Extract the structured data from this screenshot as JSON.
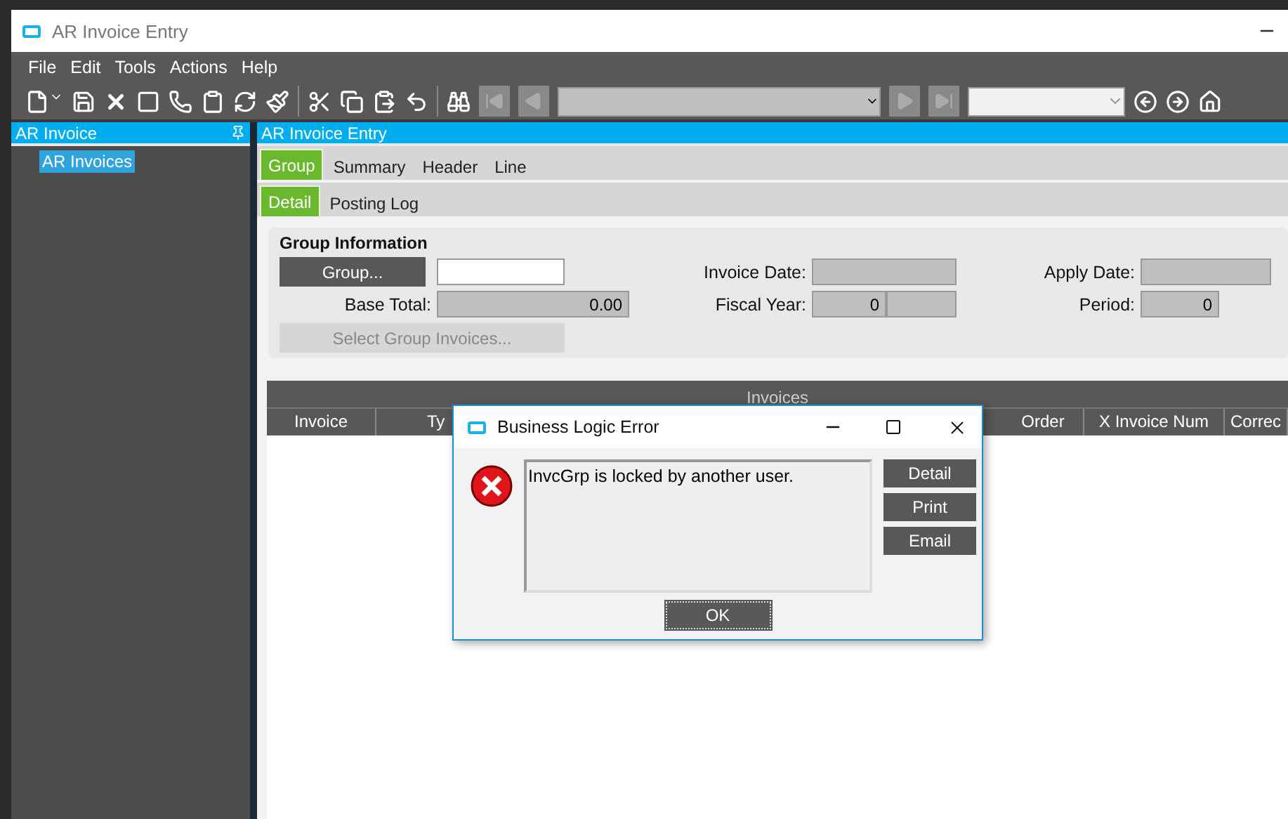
{
  "window": {
    "title": "AR Invoice Entry"
  },
  "menu": [
    "File",
    "Edit",
    "Tools",
    "Actions",
    "Help"
  ],
  "sidebar": {
    "title": "AR Invoice",
    "items": [
      {
        "label": "AR Invoices",
        "selected": true
      }
    ]
  },
  "panel": {
    "title": "AR Invoice Entry"
  },
  "tabs": [
    {
      "label": "Group",
      "selected": true
    },
    {
      "label": "Summary",
      "selected": false
    },
    {
      "label": "Header",
      "selected": false
    },
    {
      "label": "Line",
      "selected": false
    }
  ],
  "subtabs": [
    {
      "label": "Detail",
      "selected": true
    },
    {
      "label": "Posting Log",
      "selected": false
    }
  ],
  "group_info": {
    "title": "Group Information",
    "group_button": "Group...",
    "base_total_label": "Base Total:",
    "base_total": "0.00",
    "invoice_date_label": "Invoice Date:",
    "fiscal_year_label": "Fiscal Year:",
    "fiscal_year": "0",
    "apply_date_label": "Apply Date:",
    "period_label": "Period:",
    "period": "0",
    "select_button": {
      "label": "Select Group Invoices...",
      "disabled": true
    }
  },
  "grid": {
    "title": "Invoices",
    "columns": [
      "Invoice",
      "Ty",
      "Order",
      "X Invoice Num",
      "Correc"
    ]
  },
  "dialog": {
    "title": "Business Logic Error",
    "message": "InvcGrp is locked by another user.",
    "side_buttons": [
      "Detail",
      "Print",
      "Email"
    ],
    "ok": "OK"
  }
}
